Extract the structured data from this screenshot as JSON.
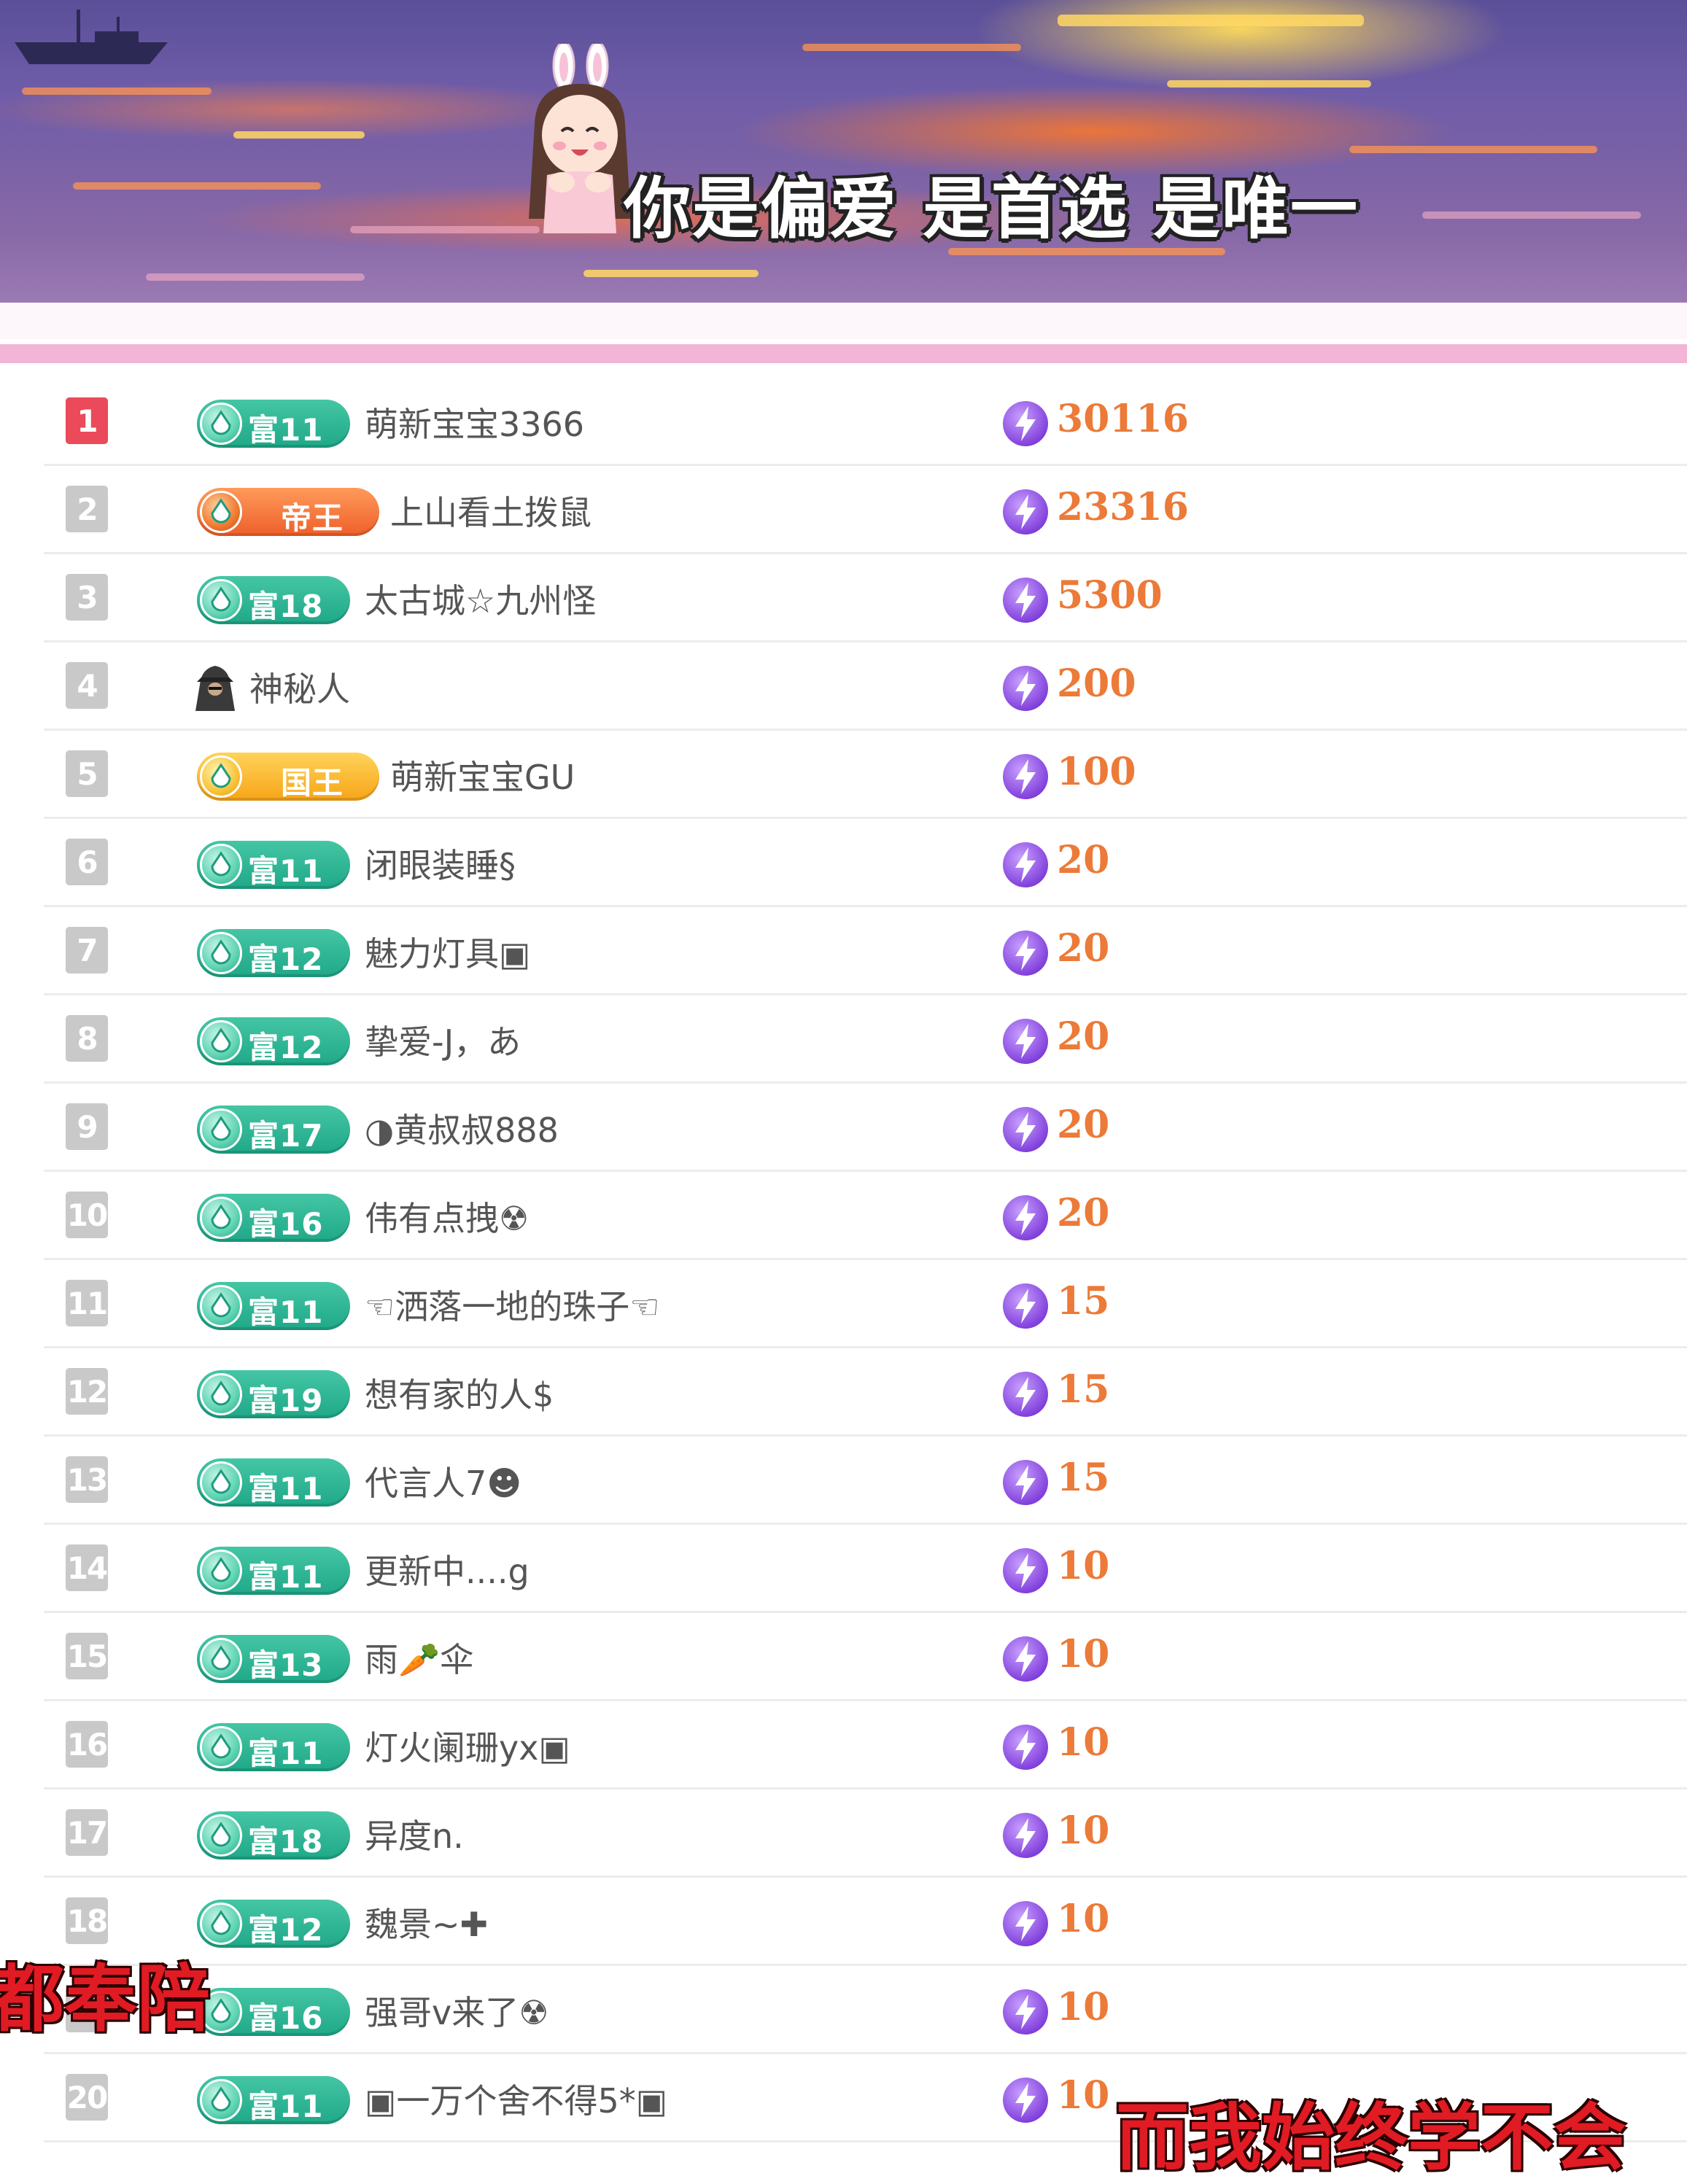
{
  "banner": {
    "caption": "你是偏爱 是首选 是唯一"
  },
  "colors": {
    "accent_pink": "#f2b5d6",
    "rank_first": "#ea4a5a",
    "rank_default": "#c9c9c9",
    "badge_green": "#2bb592",
    "score_orange": "#ec7a38",
    "bolt_purple": "#8a4de0",
    "overlay_red": "#e01b24"
  },
  "icons": {
    "score": "lightning-bolt-icon",
    "badge": "drop-medal-icon",
    "mystery": "hooded-figure-icon"
  },
  "rows": [
    {
      "rank": "1",
      "badge": "富11",
      "badge_type": "rich",
      "name": "萌新宝宝3366",
      "score": "30116"
    },
    {
      "rank": "2",
      "badge": "帝王",
      "badge_type": "emperor",
      "name": "上山看土拨鼠",
      "score": "23316"
    },
    {
      "rank": "3",
      "badge": "富18",
      "badge_type": "rich",
      "name": "太古城☆九州怪",
      "score": "5300"
    },
    {
      "rank": "4",
      "badge": "",
      "badge_type": "mystery",
      "name": "神秘人",
      "score": "200"
    },
    {
      "rank": "5",
      "badge": "国王",
      "badge_type": "king",
      "name": "萌新宝宝GU",
      "score": "100"
    },
    {
      "rank": "6",
      "badge": "富11",
      "badge_type": "rich",
      "name": "闭眼装睡§",
      "score": "20"
    },
    {
      "rank": "7",
      "badge": "富12",
      "badge_type": "rich",
      "name": "魅力灯具▣",
      "score": "20"
    },
    {
      "rank": "8",
      "badge": "富12",
      "badge_type": "rich",
      "name": "挚爱-J，あ",
      "score": "20"
    },
    {
      "rank": "9",
      "badge": "富17",
      "badge_type": "rich",
      "name": "◑黄叔叔888",
      "score": "20"
    },
    {
      "rank": "10",
      "badge": "富16",
      "badge_type": "rich",
      "name": "伟有点拽☢",
      "score": "20"
    },
    {
      "rank": "11",
      "badge": "富11",
      "badge_type": "rich",
      "name": "☜洒落一地的珠子☜",
      "score": "15"
    },
    {
      "rank": "12",
      "badge": "富19",
      "badge_type": "rich",
      "name": "想有家的人$",
      "score": "15"
    },
    {
      "rank": "13",
      "badge": "富11",
      "badge_type": "rich",
      "name": "代言人7☻",
      "score": "15"
    },
    {
      "rank": "14",
      "badge": "富11",
      "badge_type": "rich",
      "name": "更新中....g",
      "score": "10"
    },
    {
      "rank": "15",
      "badge": "富13",
      "badge_type": "rich",
      "name": "雨🥕伞",
      "score": "10"
    },
    {
      "rank": "16",
      "badge": "富11",
      "badge_type": "rich",
      "name": "灯火阑珊yx▣",
      "score": "10"
    },
    {
      "rank": "17",
      "badge": "富18",
      "badge_type": "rich",
      "name": "异度n.",
      "score": "10"
    },
    {
      "rank": "18",
      "badge": "富12",
      "badge_type": "rich",
      "name": "魏景~✚",
      "score": "10"
    },
    {
      "rank": "19",
      "badge": "富16",
      "badge_type": "rich",
      "name": "强哥v来了☢",
      "score": "10"
    },
    {
      "rank": "20",
      "badge": "富11",
      "badge_type": "rich",
      "name": "▣一万个舍不得5*▣",
      "score": "10"
    }
  ],
  "overlays": {
    "left_caption": "都奉陪",
    "right_caption": "而我始终学不会"
  }
}
